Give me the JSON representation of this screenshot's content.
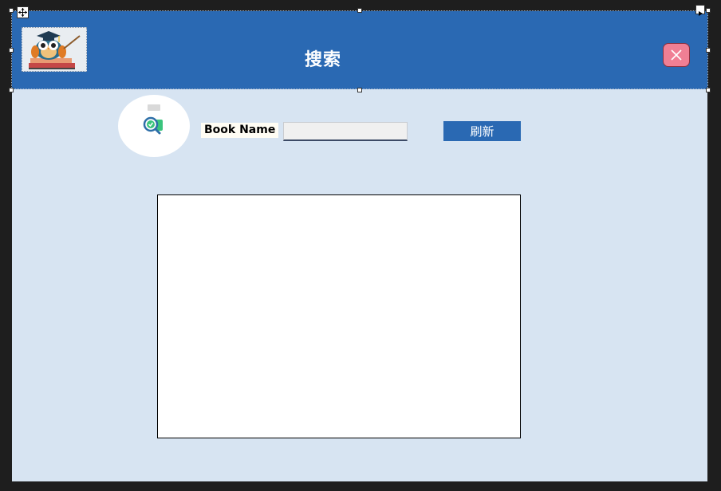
{
  "window": {
    "title": "搜索",
    "close_icon": "close-x-icon",
    "logo_icon": "owl-teacher-books-icon"
  },
  "search": {
    "picture_icon": "magnifier-check-icon",
    "book_label": "Book Name",
    "book_value": "",
    "refresh_label": "刷新"
  },
  "colors": {
    "header_bg": "#2a69b3",
    "form_bg": "#d7e4f2",
    "close_bg": "#f07f94",
    "refresh_bg": "#2a69b3"
  }
}
